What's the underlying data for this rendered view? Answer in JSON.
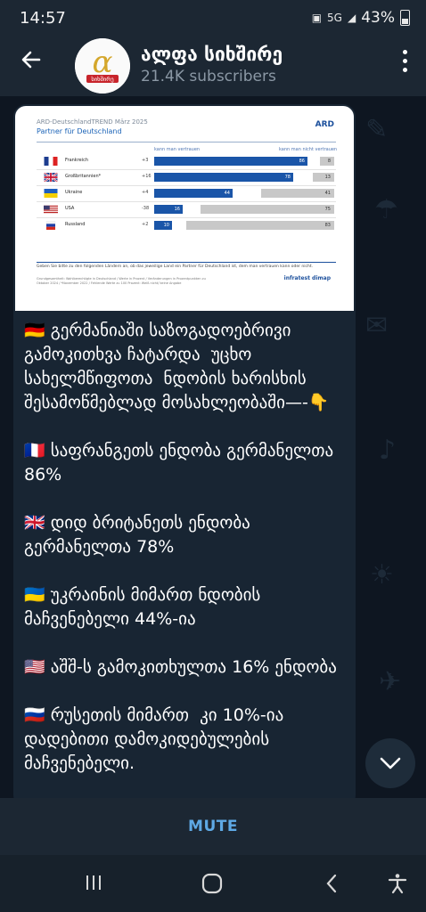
{
  "status_bar": {
    "time": "14:57",
    "network": "5G",
    "battery": "43%"
  },
  "header": {
    "channel_name": "ალფა სიხშირე",
    "subscribers": "21.4K subscribers",
    "avatar_text": "სიხშირე"
  },
  "post_image": {
    "header_line": "ARD-DeutschlandTREND März 2025",
    "subtitle": "Partner für Deutschland",
    "logo": "ARD",
    "col_trust": "kann man vertrauen",
    "col_notrust": "kann man nicht vertrauen",
    "rows": [
      {
        "country": "Frankreich",
        "delta": "+3",
        "trust": 86,
        "no_trust": "8"
      },
      {
        "country": "Großbritannien*",
        "delta": "+16",
        "trust": 78,
        "no_trust": "13"
      },
      {
        "country": "Ukraine",
        "delta": "+4",
        "trust": 44,
        "no_trust": "41"
      },
      {
        "country": "USA",
        "delta": "-38",
        "trust": 16,
        "no_trust": "75"
      },
      {
        "country": "Russland",
        "delta": "+2",
        "trust": 10,
        "no_trust": "83"
      }
    ],
    "footer_question": "Geben Sie bitte zu den folgenden Ländern an, ob das jeweilige Land ein Partner für Deutschland ist, dem man vertrauen kann oder nicht.",
    "footer_notes": "Grundgesamtheit: Wahlberechtigte in Deutschland / Werte in Prozent / Veränderungen in Prozentpunkten zu Oktober 2024 / *November 2022 / Fehlende Werte zu 100 Prozent: Weiß nicht/ keine Angabe",
    "brand": "infratest dimap"
  },
  "message": {
    "intro": "🇩🇪 გერმანიაში საზოგადოებრივი გამოკითხვა ჩატარდა  უცხო სახელმწიფოთა  ნდობის ხარისხის შესამოწმებლად მოსახლეობაში—-👇",
    "line_france": "🇫🇷 საფრანგეთს ენდობა გერმანელთა 86%",
    "line_uk": "🇬🇧 დიდ ბრიტანეთს ენდობა გერმანელთა 78%",
    "line_ukraine": "🇺🇦 უკრაინის მიმართ ნდობის მაჩვენებელი 44%-ია",
    "line_usa": "🇺🇸 აშშ-ს გამოკითხულთა 16% ენდობა",
    "line_russia": "🇷🇺 რუსეთის მიმართ  კი 10%-ია დადებითი დამოკიდებულების მაჩვენებელი."
  },
  "bottom": {
    "mute_label": "MUTE"
  },
  "colors": {
    "accent": "#5ea9e5",
    "bubble": "#182533",
    "bar_blue": "#1a55a8"
  }
}
